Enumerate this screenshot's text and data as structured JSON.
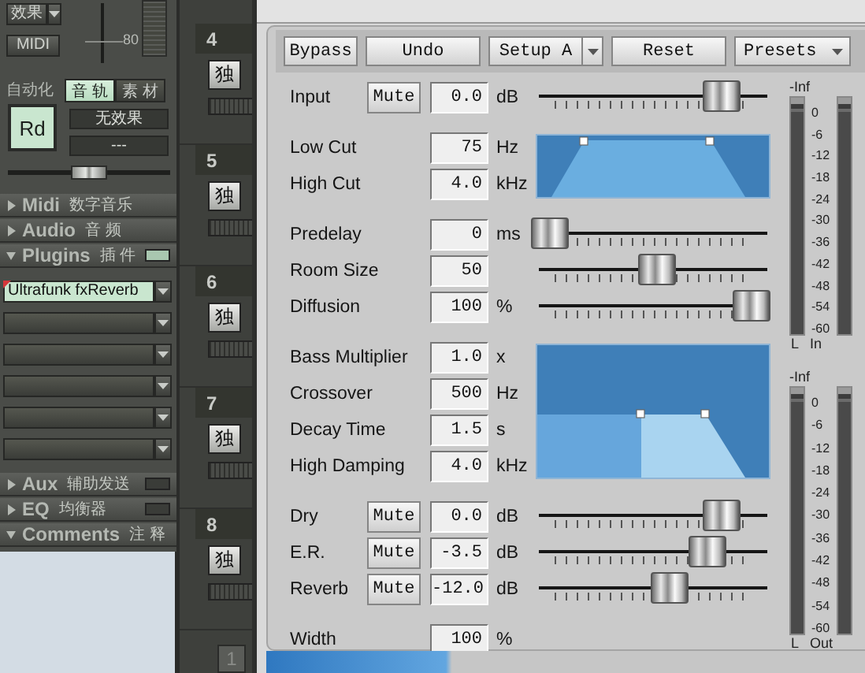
{
  "mixer": {
    "effects_button": "效果",
    "midi_button": "MIDI",
    "fader_value": "80",
    "automation_label": "自动化",
    "tabs": [
      {
        "label": "音 轨",
        "selected": true
      },
      {
        "label": "素 材",
        "selected": false
      }
    ],
    "read_button": {
      "label": "Rd",
      "on": true
    },
    "effect_field": "无效果",
    "preset_field": "---",
    "pan": {
      "level": 0.5
    },
    "sections": [
      {
        "title": "Midi",
        "subtitle": "数字音乐",
        "expanded": false
      },
      {
        "title": "Audio",
        "subtitle": "音 频",
        "expanded": false
      },
      {
        "title": "Plugins",
        "subtitle": "插 件",
        "expanded": true,
        "enabled": true,
        "slots": [
          {
            "name": "Ultrafunk fxReverb",
            "active": true
          },
          {
            "active": false
          },
          {
            "active": false
          },
          {
            "active": false
          },
          {
            "active": false
          },
          {
            "active": false
          }
        ]
      },
      {
        "title": "Aux",
        "subtitle": "辅助发送",
        "expanded": false,
        "enabled": false
      },
      {
        "title": "EQ",
        "subtitle": "均衡器",
        "expanded": false,
        "enabled": false
      },
      {
        "title": "Comments",
        "subtitle": "注 释",
        "expanded": true
      }
    ]
  },
  "channels": [
    {
      "number": "4",
      "solo_button": "独"
    },
    {
      "number": "5",
      "solo_button": "独"
    },
    {
      "number": "6",
      "solo_button": "独"
    },
    {
      "number": "7",
      "solo_button": "独"
    },
    {
      "number": "8",
      "solo_button": "独"
    }
  ],
  "bank_button": "1",
  "plugin": {
    "toolbar": [
      {
        "label": "Bypass",
        "kind": "button"
      },
      {
        "label": "Undo",
        "kind": "button"
      },
      {
        "label": "Setup A",
        "kind": "split"
      },
      {
        "label": "Reset",
        "kind": "button"
      },
      {
        "label": "Presets",
        "kind": "dropdown"
      }
    ],
    "groups": [
      {
        "kind": "plain",
        "params": [
          {
            "label": "Input",
            "mute": "Mute",
            "value": "0.0",
            "unit": "dB",
            "level": 0.8
          }
        ]
      },
      {
        "kind": "filter",
        "params": [
          {
            "label": "Low Cut",
            "value": "75",
            "unit": "Hz"
          },
          {
            "label": "High Cut",
            "value": "4.0",
            "unit": "kHz"
          }
        ]
      },
      {
        "kind": "plain",
        "params": [
          {
            "label": "Predelay",
            "value": "0",
            "unit": "ms",
            "level": 0.05
          },
          {
            "label": "Room Size",
            "value": "50",
            "level": 0.52
          },
          {
            "label": "Diffusion",
            "value": "100",
            "unit": "%",
            "level": 0.93
          }
        ]
      },
      {
        "kind": "decay",
        "params": [
          {
            "label": "Bass Multiplier",
            "value": "1.0",
            "unit": "x"
          },
          {
            "label": "Crossover",
            "value": "500",
            "unit": "Hz"
          },
          {
            "label": "Decay Time",
            "value": "1.5",
            "unit": "s"
          },
          {
            "label": "High Damping",
            "value": "4.0",
            "unit": "kHz"
          }
        ]
      },
      {
        "kind": "plain",
        "params": [
          {
            "label": "Dry",
            "mute": "Mute",
            "value": "0.0",
            "unit": "dB",
            "level": 0.8
          },
          {
            "label": "E.R.",
            "mute": "Mute",
            "value": "-3.5",
            "unit": "dB",
            "level": 0.74
          },
          {
            "label": "Reverb",
            "mute": "Mute",
            "value": "-12.0",
            "unit": "dB",
            "level": 0.57
          }
        ]
      },
      {
        "kind": "plain",
        "params": [
          {
            "label": "Width",
            "value": "100",
            "unit": "%"
          }
        ]
      }
    ],
    "meters": [
      {
        "peak": "-Inf",
        "scale": [
          "0",
          "-6",
          "-12",
          "-18",
          "-24",
          "-30",
          "-36",
          "-42",
          "-48",
          "-54",
          "-60"
        ],
        "channel": "L",
        "label": "In"
      },
      {
        "peak": "-Inf",
        "scale": [
          "0",
          "-6",
          "-12",
          "-18",
          "-24",
          "-30",
          "-36",
          "-42",
          "-48",
          "-54",
          "-60"
        ],
        "channel": "L",
        "label": "Out"
      }
    ]
  }
}
